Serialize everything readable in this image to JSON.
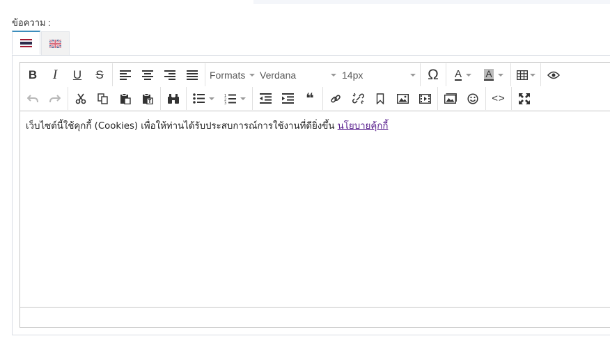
{
  "field": {
    "label": "ข้อความ :"
  },
  "lang_tabs": [
    {
      "icon": "thai-flag-icon",
      "active": true
    },
    {
      "icon": "uk-flag-icon",
      "active": false
    }
  ],
  "toolbar": {
    "formats_label": "Formats",
    "font_family": "Verdana",
    "font_size": "14px",
    "special_char_symbol": "Ω",
    "text_color_letter": "A",
    "bg_color_letter": "A",
    "quote_symbol": "❝",
    "code_symbol": "<>",
    "bold_letter": "B",
    "italic_letter": "I",
    "underline_letter": "U",
    "strike_letter": "S"
  },
  "content": {
    "text": "เว็บไซต์นี้ใช้คุกกี้ (Cookies) เพื่อให้ท่านได้รับประสบการณ์การใช้งานที่ดียิ่งขึ้น ",
    "link": "นโยบายคุ้กกี้"
  },
  "colors": {
    "accent": "#3c8dbc",
    "border": "#c5c5c5",
    "link": "#551a8b"
  }
}
